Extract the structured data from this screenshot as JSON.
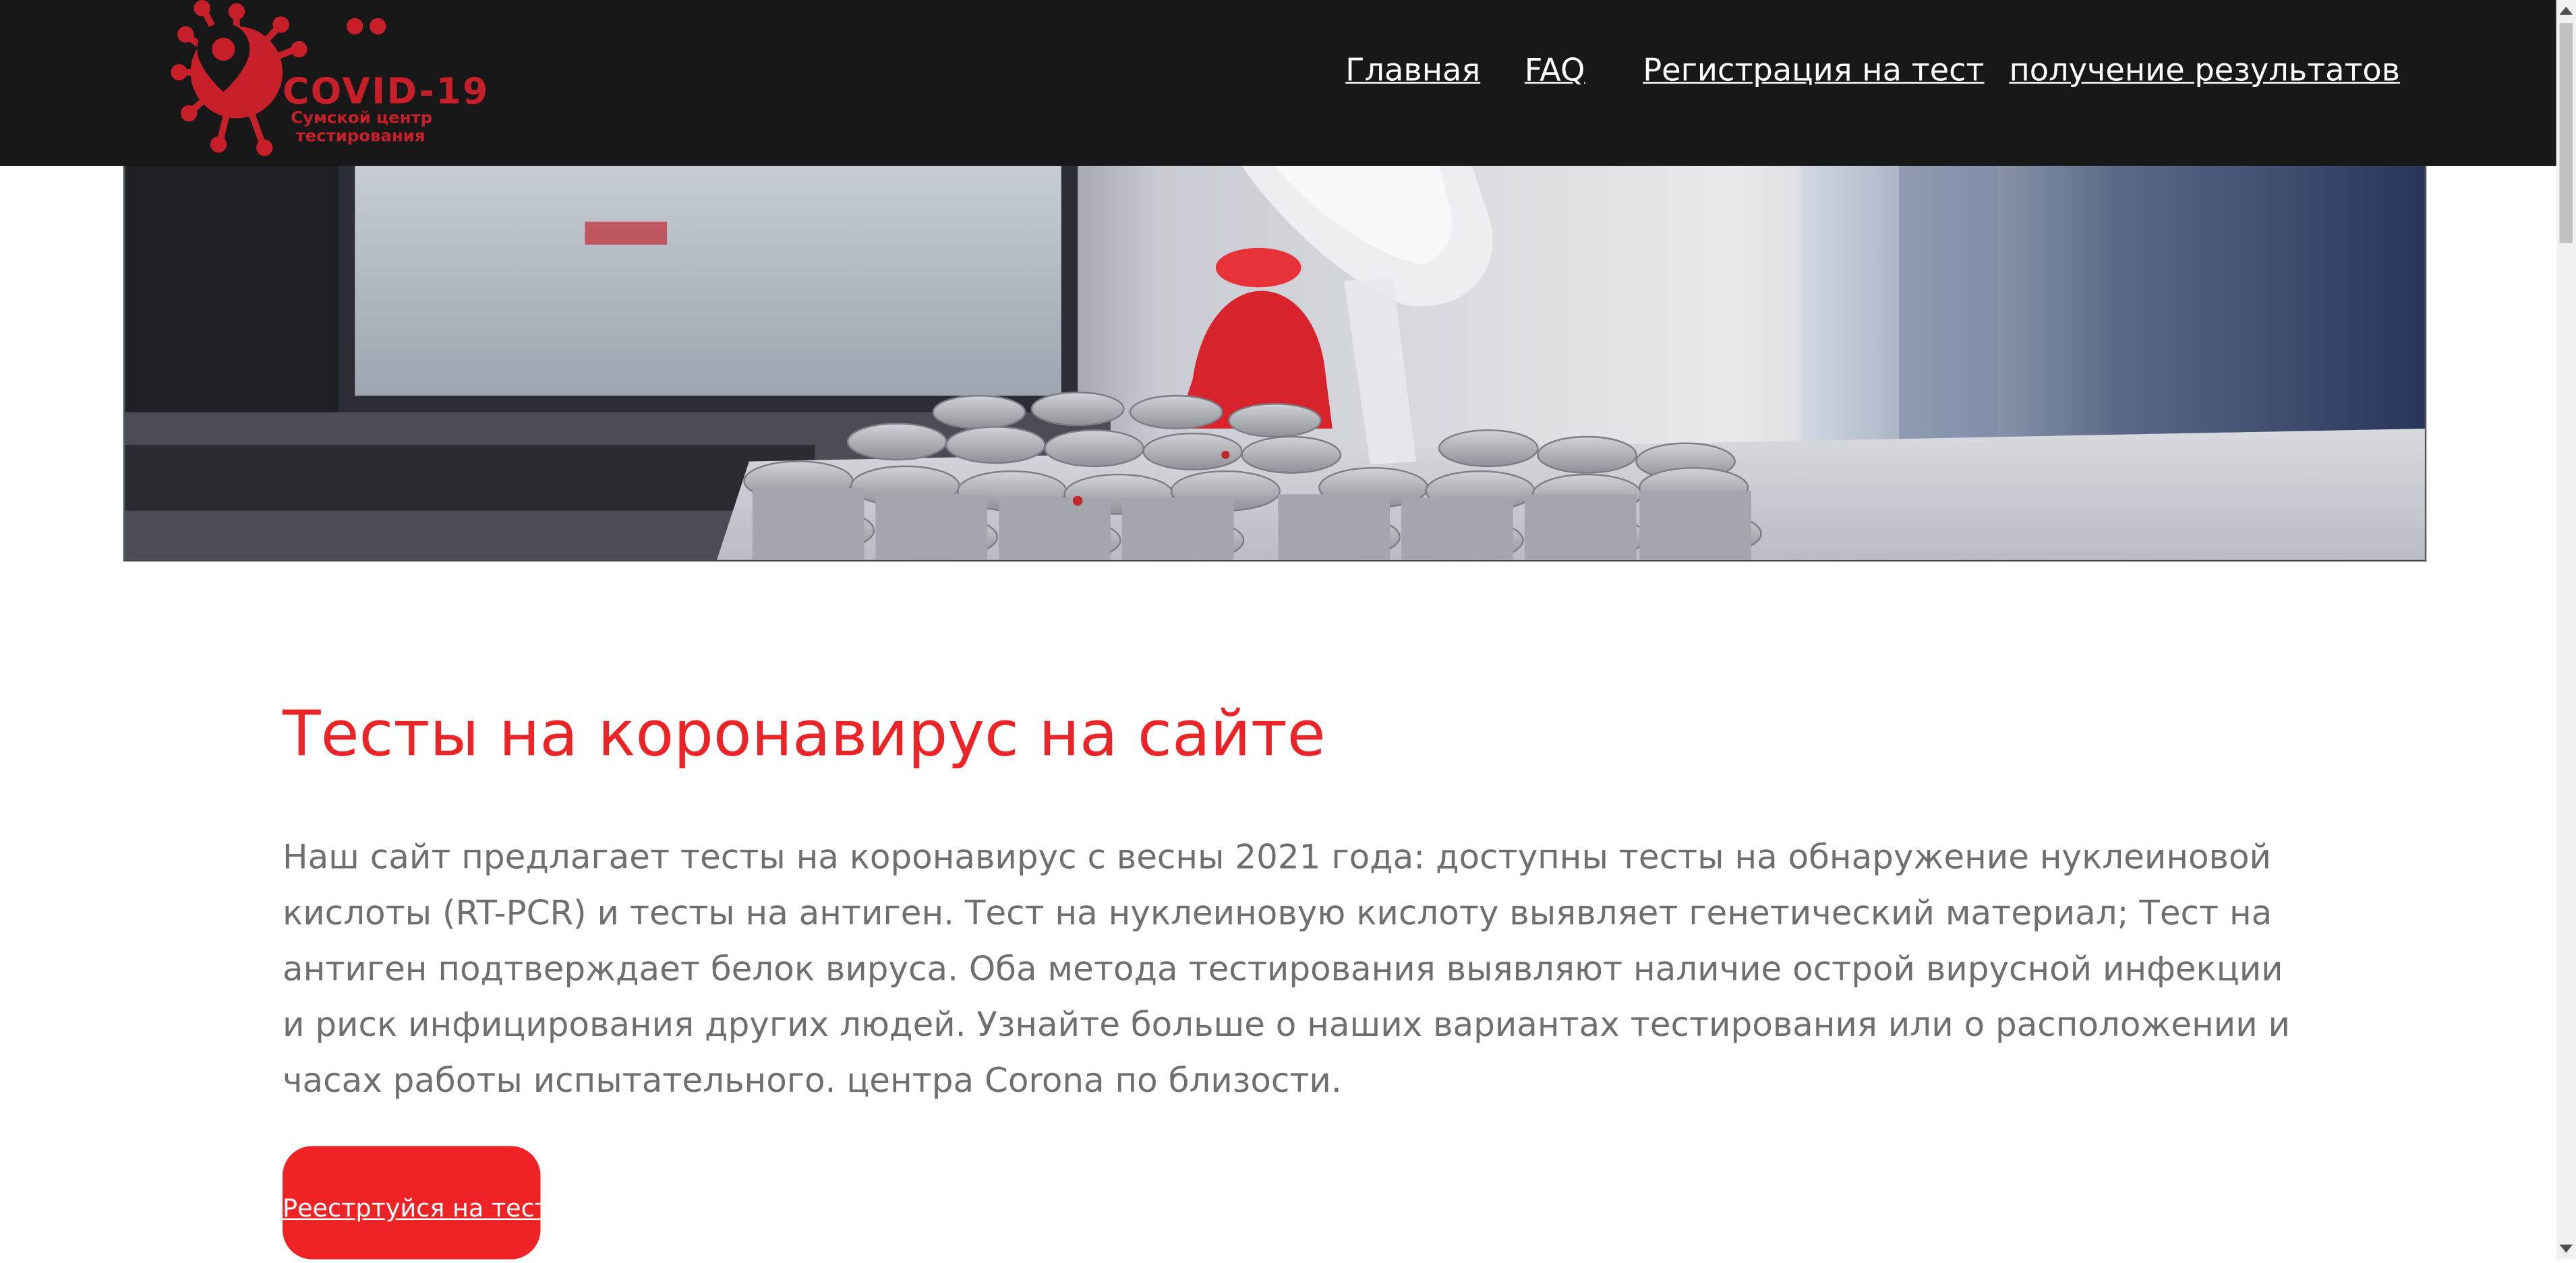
{
  "header": {
    "logo": {
      "title": "COVID-19",
      "subtitle_line1": "Сумской центр",
      "subtitle_line2": "тестирования",
      "icon": "coronavirus-pin-icon"
    },
    "nav": [
      {
        "label": "Главная"
      },
      {
        "label": "FAQ"
      },
      {
        "label": "Регистрация на тест"
      },
      {
        "label": "получение результатов"
      }
    ]
  },
  "hero": {
    "image": "lab-test-tubes-photo"
  },
  "main": {
    "title": "Тесты на коронавирус на сайте",
    "paragraph": "Наш сайт предлагает тесты на коронавирус с весны 2021 года: доступны тесты на обнаружение нуклеиновой кислоты (RT-PCR) и тесты на антиген. Тест на нуклеиновую кислоту выявляет генетический материал; Тест на антиген подтверждает белок вируса. Оба метода тестирования выявляют наличие острой вирусной инфекции и риск инфицирования других людей. Узнайте больше о наших вариантах тестирования или о расположении и часах работы испытательного. центра Corona по близости.",
    "cta_label": "Реестртуйся на тест"
  },
  "colors": {
    "header_bg": "#181818",
    "accent_red": "#ea2427",
    "button_red": "#ef2326",
    "logo_red": "#c8202b",
    "text_gray": "#6f6f6f"
  }
}
